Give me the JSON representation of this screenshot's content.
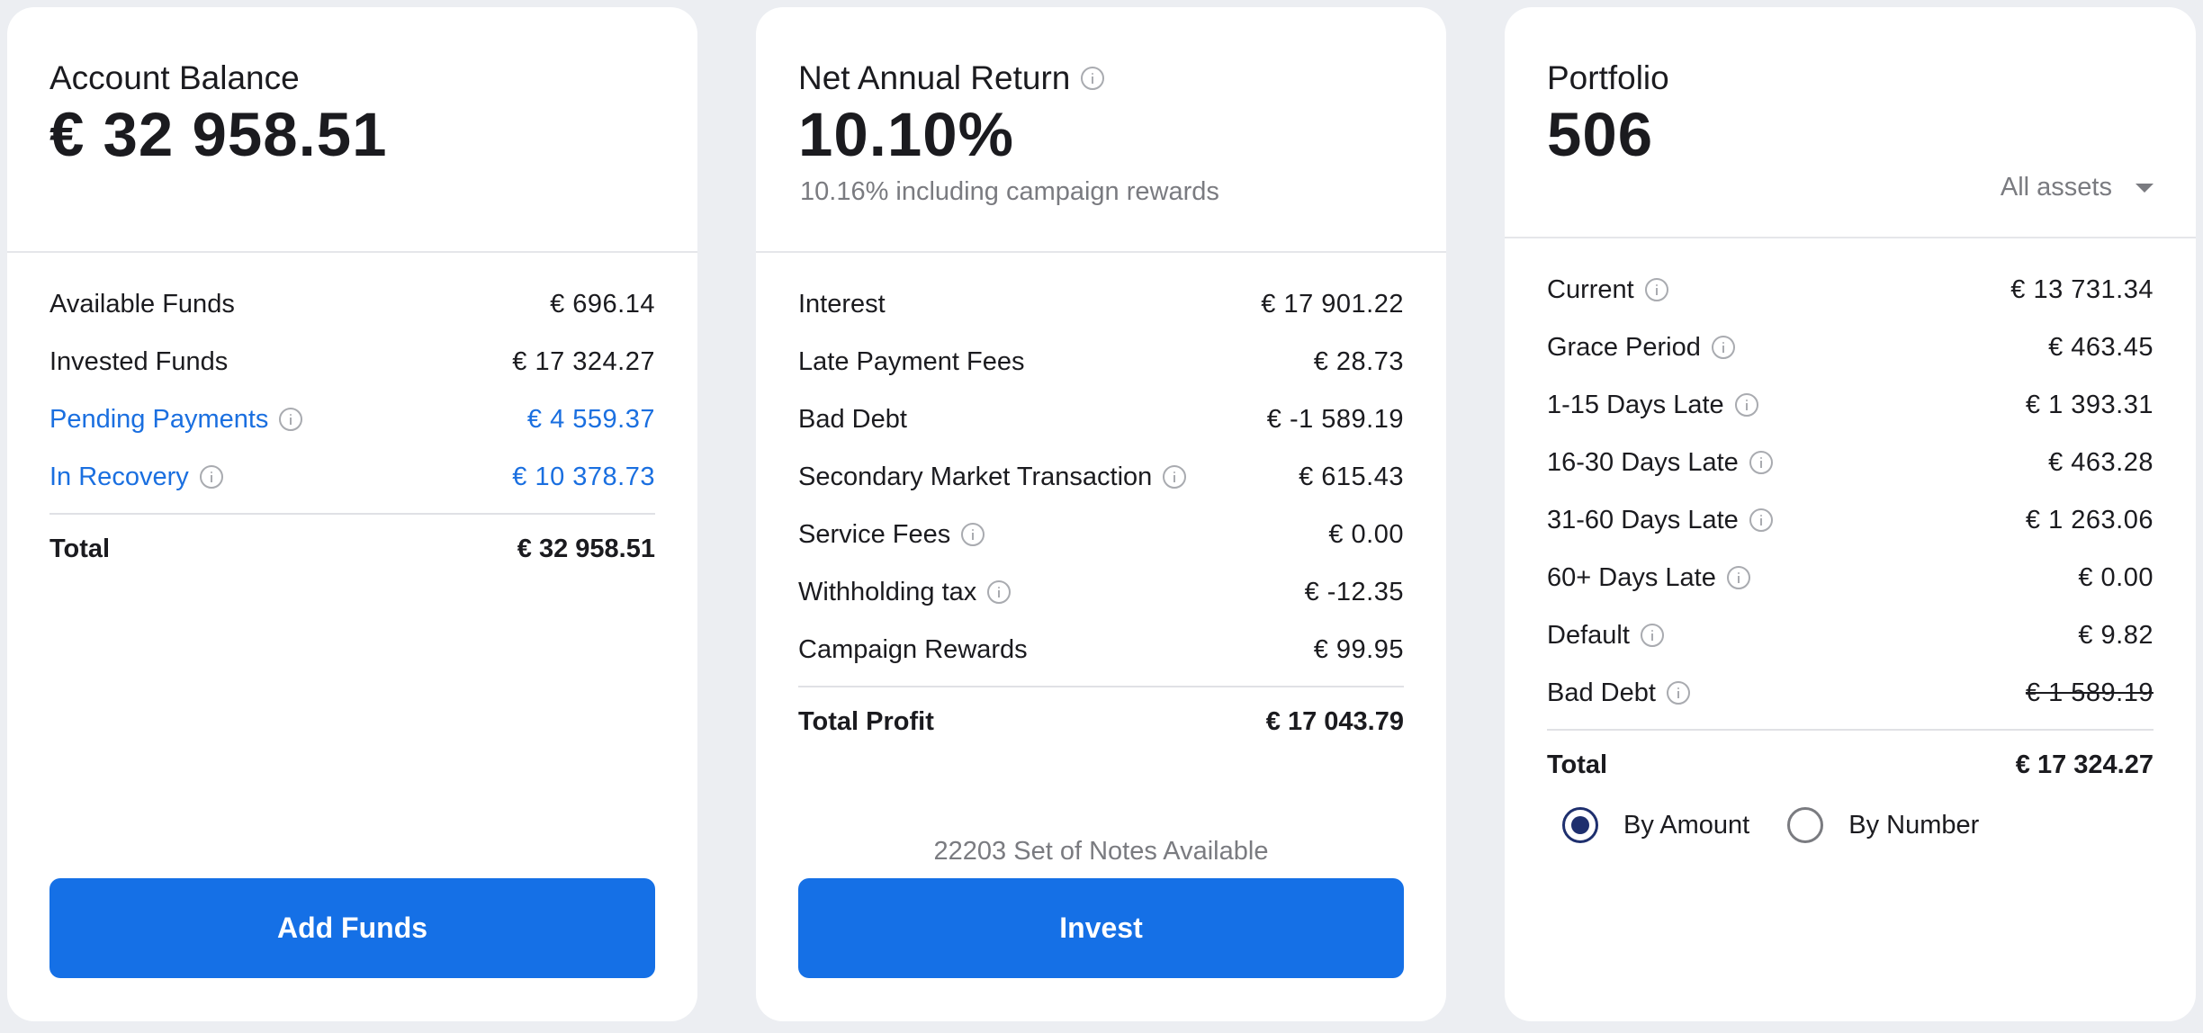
{
  "account_balance": {
    "title": "Account Balance",
    "value": "€ 32 958.51",
    "rows": [
      {
        "label": "Available Funds",
        "amount": "€ 696.14"
      },
      {
        "label": "Invested Funds",
        "amount": "€ 17 324.27"
      },
      {
        "label": "Pending Payments",
        "amount": "€ 4 559.37"
      },
      {
        "label": "In Recovery",
        "amount": "€ 10 378.73"
      }
    ],
    "total_label": "Total",
    "total_amount": "€ 32 958.51",
    "button_label": "Add Funds"
  },
  "net_annual_return": {
    "title": "Net Annual Return",
    "value": "10.10%",
    "subtitle": "10.16% including campaign rewards",
    "rows": [
      {
        "label": "Interest",
        "amount": "€ 17 901.22"
      },
      {
        "label": "Late Payment Fees",
        "amount": "€ 28.73"
      },
      {
        "label": "Bad Debt",
        "amount": "€ -1 589.19"
      },
      {
        "label": "Secondary Market Transaction",
        "amount": "€ 615.43"
      },
      {
        "label": "Service Fees",
        "amount": "€ 0.00"
      },
      {
        "label": "Withholding tax",
        "amount": "€ -12.35"
      },
      {
        "label": "Campaign Rewards",
        "amount": "€ 99.95"
      }
    ],
    "total_label": "Total Profit",
    "total_amount": "€ 17 043.79",
    "notes_available": "22203 Set of Notes Available",
    "button_label": "Invest"
  },
  "portfolio": {
    "title": "Portfolio",
    "value": "506",
    "filter_selected": "All assets",
    "rows": [
      {
        "label": "Current",
        "amount": "€ 13 731.34"
      },
      {
        "label": "Grace Period",
        "amount": "€ 463.45"
      },
      {
        "label": "1-15 Days Late",
        "amount": "€ 1 393.31"
      },
      {
        "label": "16-30 Days Late",
        "amount": "€ 463.28"
      },
      {
        "label": "31-60 Days Late",
        "amount": "€ 1 263.06"
      },
      {
        "label": "60+ Days Late",
        "amount": "€ 0.00"
      },
      {
        "label": "Default",
        "amount": "€ 9.82"
      },
      {
        "label": "Bad Debt",
        "amount": "€ 1 589.19"
      }
    ],
    "total_label": "Total",
    "total_amount": "€ 17 324.27",
    "radio_options": [
      {
        "label": "By Amount",
        "checked": true
      },
      {
        "label": "By Number",
        "checked": false
      }
    ]
  },
  "colors": {
    "accent": "#1570e6",
    "link": "#1a6fe0",
    "radio_checked": "#1e2f6e",
    "background": "#eceef2"
  }
}
